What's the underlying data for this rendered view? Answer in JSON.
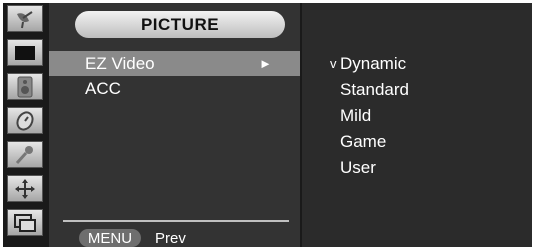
{
  "sidebar": {
    "icons": [
      {
        "name": "satellite-dish-icon",
        "selected": false
      },
      {
        "name": "picture-icon",
        "selected": true
      },
      {
        "name": "speaker-icon",
        "selected": false
      },
      {
        "name": "clock-icon",
        "selected": false
      },
      {
        "name": "key-icon",
        "selected": false
      },
      {
        "name": "move-icon",
        "selected": false
      },
      {
        "name": "pip-icon",
        "selected": false
      }
    ]
  },
  "menu": {
    "title": "PICTURE",
    "items": [
      {
        "label": "EZ Video",
        "arrow": "►",
        "selected": true
      },
      {
        "label": "ACC",
        "selected": false
      }
    ],
    "footer": {
      "button": "MENU",
      "label": "Prev"
    }
  },
  "options": {
    "check_mark": "v",
    "items": [
      {
        "label": "Dynamic",
        "checked": true
      },
      {
        "label": "Standard",
        "checked": false
      },
      {
        "label": "Mild",
        "checked": false
      },
      {
        "label": "Game",
        "checked": false
      },
      {
        "label": "User",
        "checked": false
      }
    ]
  },
  "colors": {
    "background": "#2b2b2b",
    "highlight": "#8a8a8a",
    "text": "#ffffff"
  }
}
